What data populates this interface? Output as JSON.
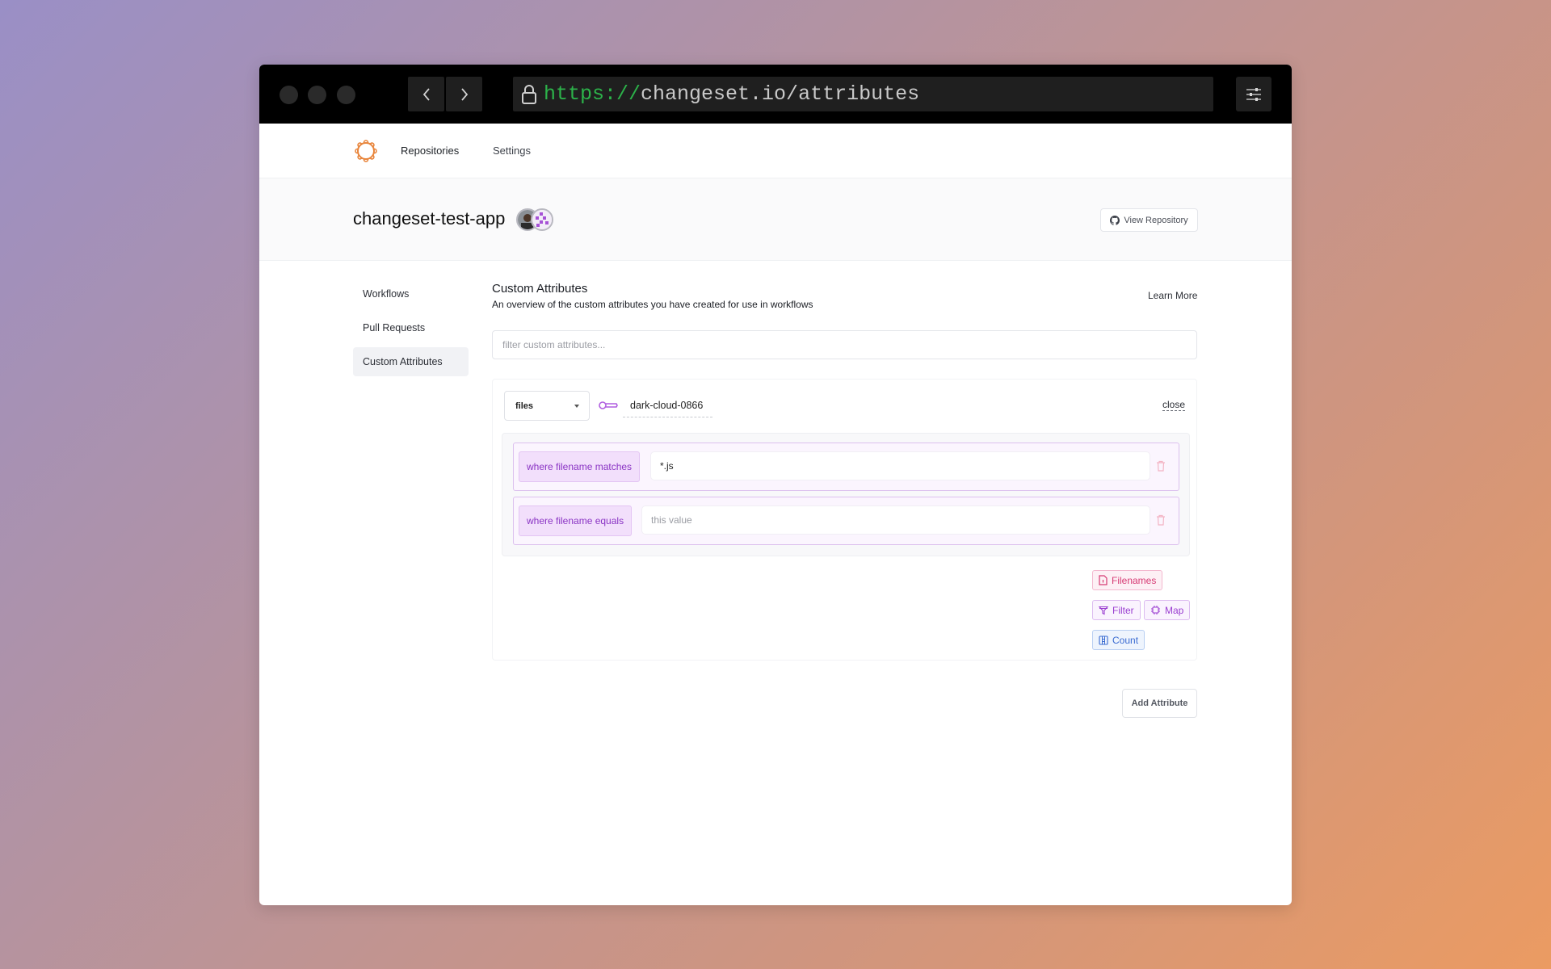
{
  "browser": {
    "url_scheme": "https://",
    "url_rest": "changeset.io/attributes"
  },
  "topnav": {
    "links": [
      {
        "label": "Repositories"
      },
      {
        "label": "Settings"
      }
    ]
  },
  "header": {
    "repo_title": "changeset-test-app",
    "view_repo_label": "View Repository"
  },
  "sidebar": {
    "items": [
      {
        "label": "Workflows",
        "active": false
      },
      {
        "label": "Pull Requests",
        "active": false
      },
      {
        "label": "Custom Attributes",
        "active": true
      }
    ]
  },
  "main": {
    "title": "Custom Attributes",
    "subtitle": "An overview of the custom attributes you have created for use in workflows",
    "learn_more": "Learn More",
    "filter_placeholder": "filter custom attributes...",
    "attribute": {
      "type": "files",
      "name": "dark-cloud-0866",
      "close_label": "close",
      "conditions": [
        {
          "label": "where filename matches",
          "value": "*.js",
          "placeholder": ""
        },
        {
          "label": "where filename equals",
          "value": "",
          "placeholder": "this value"
        }
      ],
      "chips": {
        "filenames": "Filenames",
        "filter": "Filter",
        "map": "Map",
        "count": "Count"
      }
    },
    "add_attribute_label": "Add Attribute"
  },
  "colors": {
    "accent_orange": "#e8843a",
    "purple": "#9a3ed0",
    "pink": "#d63a73",
    "blue": "#3a6bd1",
    "url_green": "#2cb24a"
  }
}
